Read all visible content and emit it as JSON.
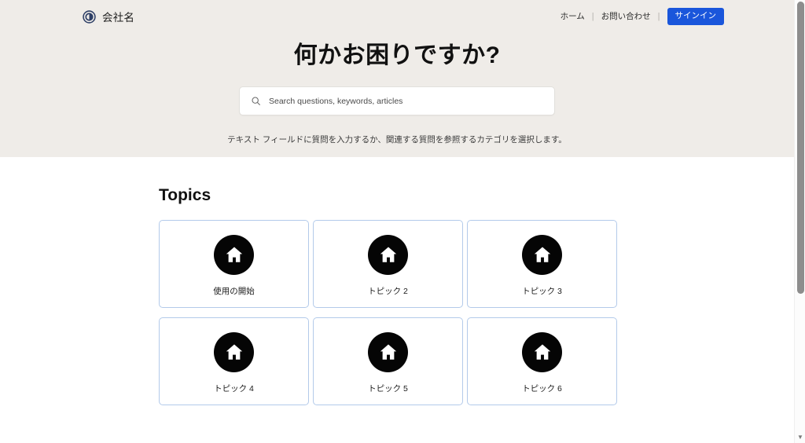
{
  "header": {
    "logo_icon": "circle-ring-logo-icon",
    "brand_name": "会社名",
    "nav": [
      {
        "label": "ホーム"
      },
      {
        "label": "お問い合わせ"
      }
    ],
    "separator": "|",
    "signin_label": "サインイン",
    "signin_color": "#1a56db"
  },
  "hero": {
    "title": "何かお困りですか?",
    "background_color": "#efece8",
    "subtitle": "テキスト フィールドに質問を入力するか、関連する質問を参照するカテゴリを選択します。"
  },
  "search": {
    "icon": "search-icon",
    "value": "",
    "placeholder": "Search questions, keywords, articles"
  },
  "topics": {
    "section_title": "Topics",
    "card_border_color": "#b3caea",
    "icon_background": "#050505",
    "items": [
      {
        "label": "使用の開始",
        "icon": "home-icon"
      },
      {
        "label": "トピック 2",
        "icon": "home-icon"
      },
      {
        "label": "トピック 3",
        "icon": "home-icon"
      },
      {
        "label": "トピック 4",
        "icon": "home-icon"
      },
      {
        "label": "トピック 5",
        "icon": "home-icon"
      },
      {
        "label": "トピック 6",
        "icon": "home-icon"
      }
    ]
  },
  "scrollbar": {
    "down_arrow": "▼"
  }
}
